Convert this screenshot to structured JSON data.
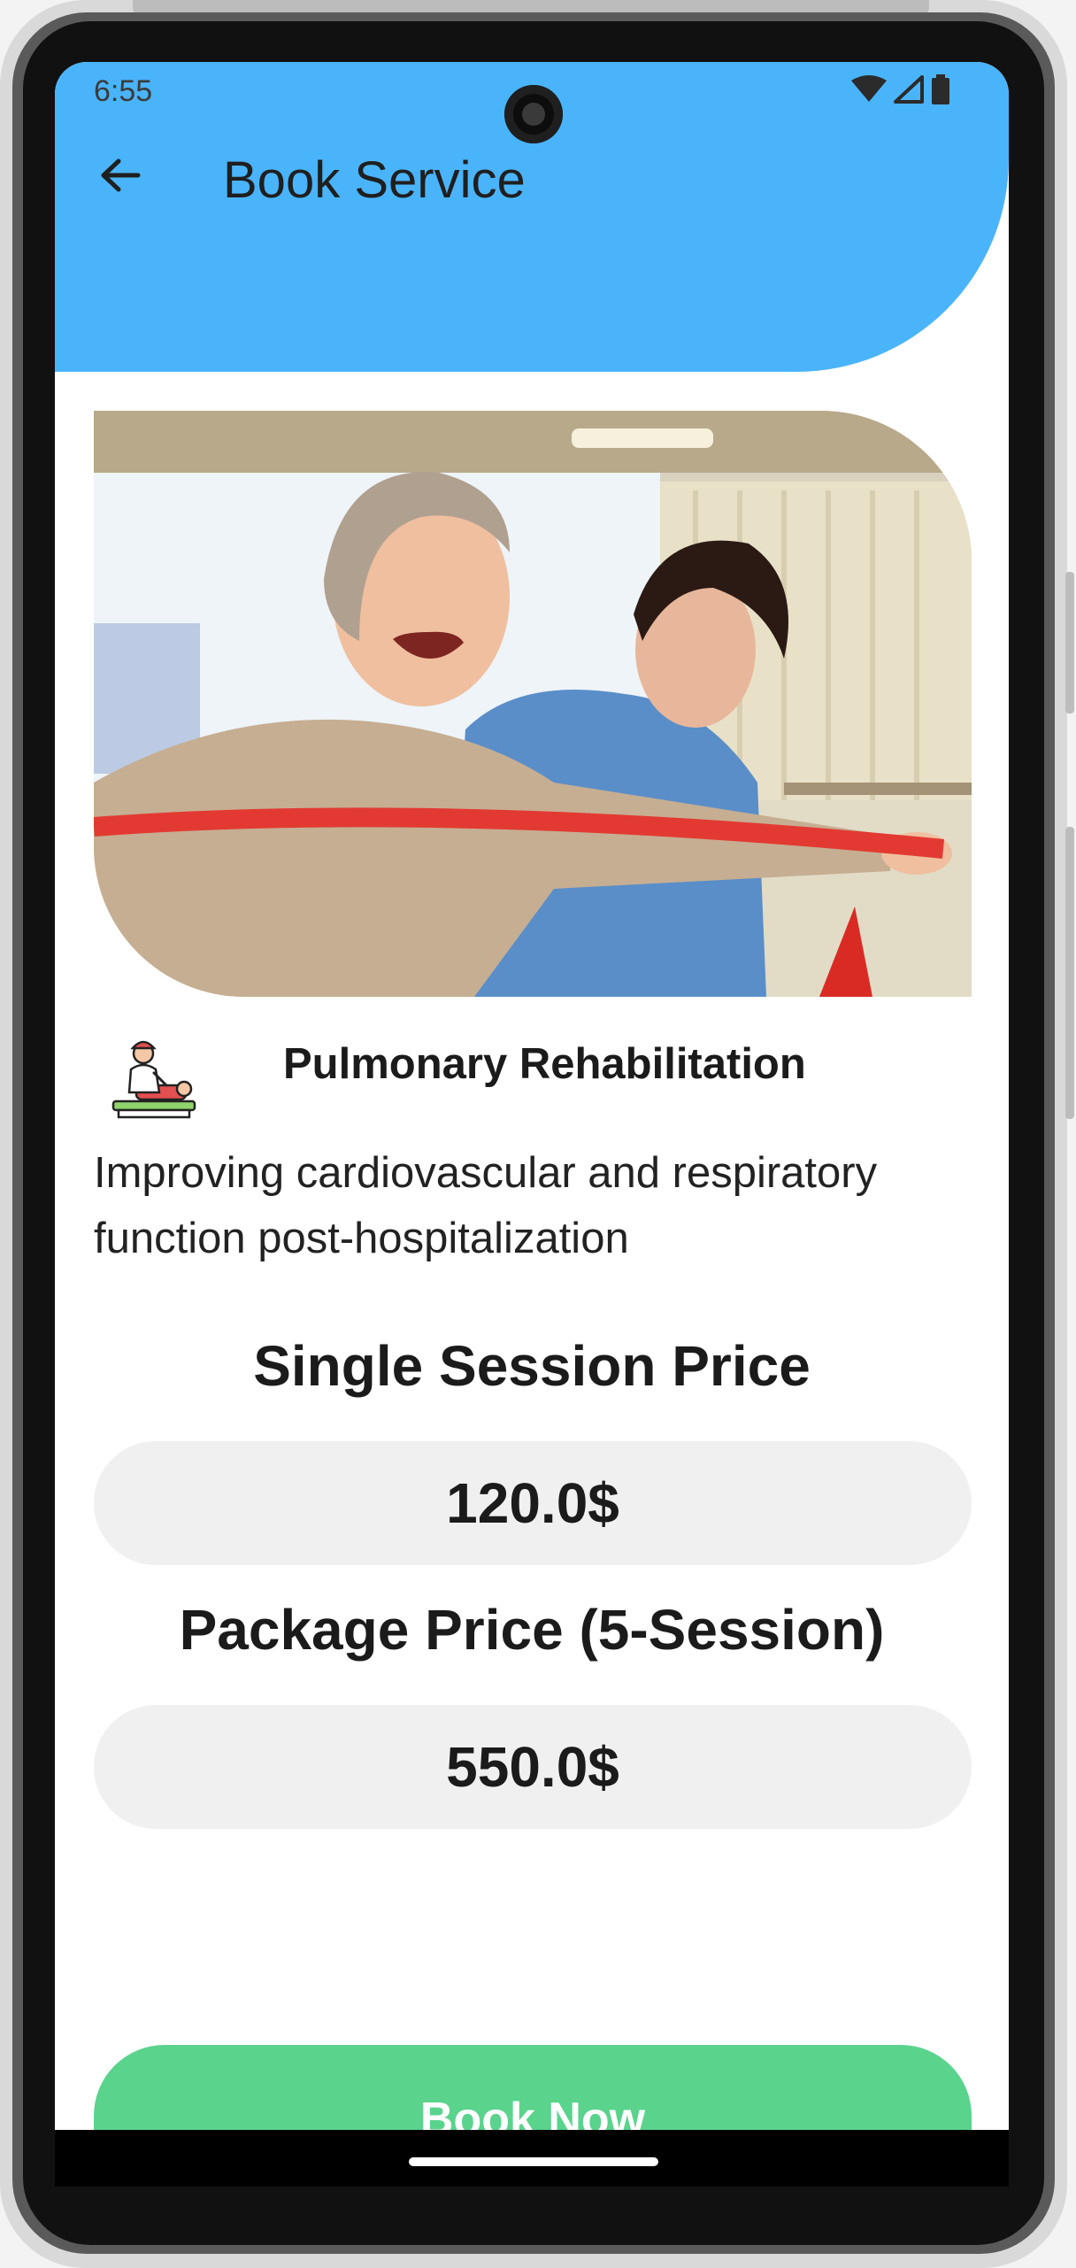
{
  "status_bar": {
    "time": "6:55",
    "icons": [
      "wifi-icon",
      "signal-icon",
      "battery-icon"
    ]
  },
  "app_bar": {
    "back_icon": "arrow-left-icon",
    "title": "Book Service",
    "color": "#4ab4fb"
  },
  "service": {
    "icon": "physiotherapy-icon",
    "name": "Pulmonary Rehabilitation",
    "description": "Improving cardiovascular and respiratory function post-hospitalization"
  },
  "pricing": {
    "single_title": "Single Session Price",
    "single_price": "120.0$",
    "package_title": "Package Price (5-Session)",
    "package_price": "550.0$"
  },
  "actions": {
    "book_label": "Book Now",
    "book_color": "#5ad38d"
  }
}
